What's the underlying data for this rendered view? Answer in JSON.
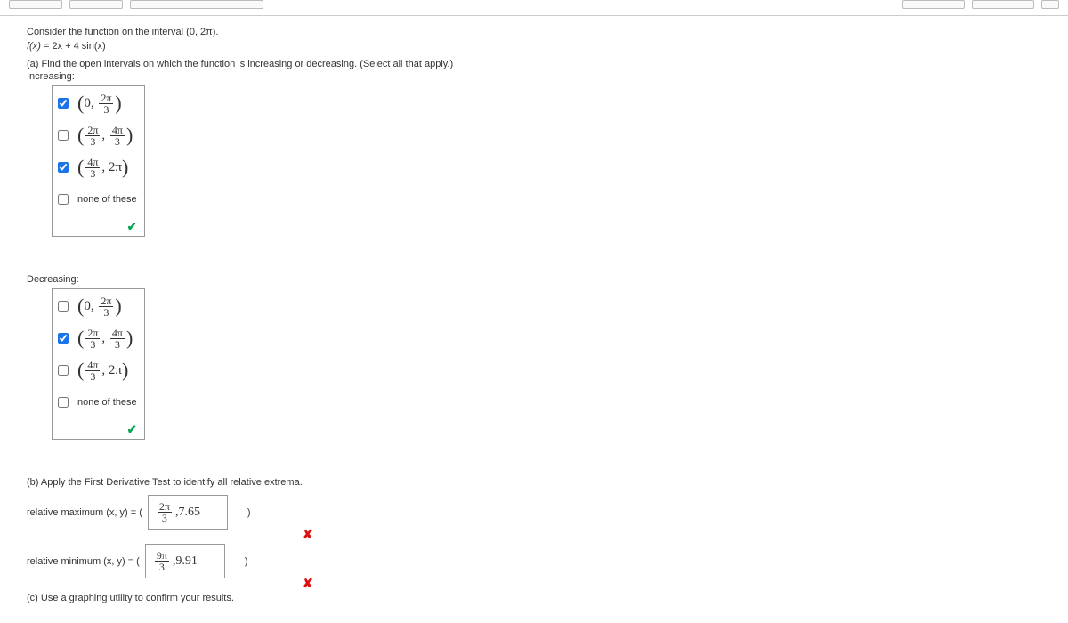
{
  "intro": "Consider the function on the interval (0, 2π).",
  "function_line": {
    "lhs": "f(x)",
    "eq": " = ",
    "rhs": "2x + 4 sin(x)"
  },
  "part_a": "(a) Find the open intervals on which the function is increasing or decreasing. (Select all that apply.)",
  "increasing_label": "Increasing:",
  "decreasing_label": "Decreasing:",
  "options": {
    "opt1": {
      "a_left": "0",
      "frac_num": "2π",
      "frac_den": "3"
    },
    "opt2": {
      "frac1_num": "2π",
      "frac1_den": "3",
      "frac2_num": "4π",
      "frac2_den": "3"
    },
    "opt3": {
      "frac_num": "4π",
      "frac_den": "3",
      "a_right": "2π"
    },
    "opt4": "none of these"
  },
  "increasing_checked": {
    "c1": true,
    "c2": false,
    "c3": true,
    "c4": false
  },
  "decreasing_checked": {
    "c1": false,
    "c2": true,
    "c3": false,
    "c4": false
  },
  "correct_mark": "✔",
  "wrong_mark": "✘",
  "part_b": "(b) Apply the First Derivative Test to identify all relative extrema.",
  "answers": [
    {
      "label": "relative maximum (x, y)  =  (",
      "frac_num": "2π",
      "frac_den": "3",
      "val": ",7.65",
      "close": ")"
    },
    {
      "label": "relative minimum  (x, y)  =  (",
      "frac_num": "9π",
      "frac_den": "3",
      "val": ",9.91",
      "close": ")"
    }
  ],
  "part_c": "(c) Use a graphing utility to confirm your results."
}
